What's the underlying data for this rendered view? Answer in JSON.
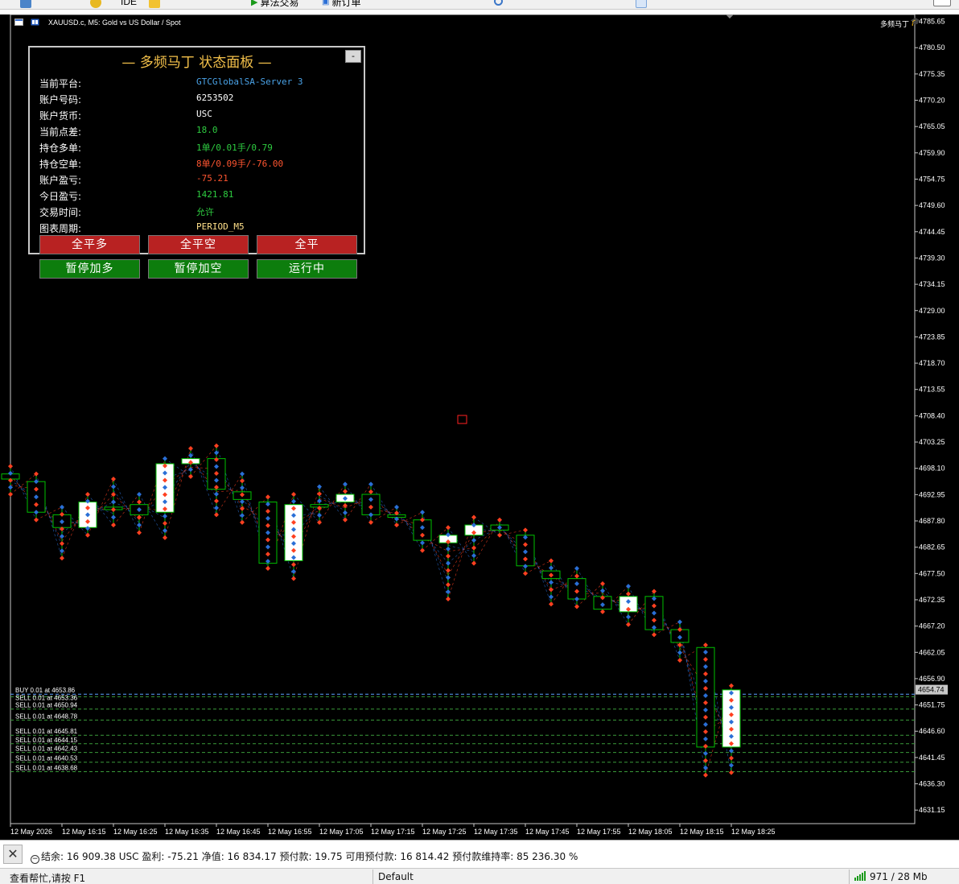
{
  "toolbar": {
    "algo_trading_label": "算法交易",
    "new_order_label": "新订单",
    "ide_label": "IDE"
  },
  "chart": {
    "title": "XAUUSD.c, M5:  Gold vs US Dollar / Spot",
    "ea_name": "多频马丁",
    "ea_icon": "graduation-cap-icon",
    "current_price": "4654.74",
    "y_ticks": [
      "4785.65",
      "4780.50",
      "4775.35",
      "4770.20",
      "4765.05",
      "4759.90",
      "4754.75",
      "4749.60",
      "4744.45",
      "4739.30",
      "4734.15",
      "4729.00",
      "4723.85",
      "4718.70",
      "4713.55",
      "4708.40",
      "4703.25",
      "4698.10",
      "4692.95",
      "4687.80",
      "4682.65",
      "4677.50",
      "4672.35",
      "4667.20",
      "4662.05",
      "4656.90",
      "4651.75",
      "4646.60",
      "4641.45",
      "4636.30",
      "4631.15"
    ],
    "x_ticks": [
      "12 May 2026",
      "12 May 16:15",
      "12 May 16:25",
      "12 May 16:35",
      "12 May 16:45",
      "12 May 16:55",
      "12 May 17:05",
      "12 May 17:15",
      "12 May 17:25",
      "12 May 17:35",
      "12 May 17:45",
      "12 May 17:55",
      "12 May 18:05",
      "12 May 18:15",
      "12 May 18:25"
    ],
    "order_lines": [
      {
        "label": "BUY 0.01 at 4653.86",
        "price": 4653.86,
        "side": "buy"
      },
      {
        "label": "SELL 0.01 at 4653.36",
        "price": 4653.36,
        "side": "sell"
      },
      {
        "label": "SELL 0.01 at 4650.94",
        "price": 4650.94,
        "side": "sell"
      },
      {
        "label": "SELL 0.01 at 4648.78",
        "price": 4648.78,
        "side": "sell"
      },
      {
        "label": "SELL 0.01 at 4645.81",
        "price": 4645.81,
        "side": "sell"
      },
      {
        "label": "SELL 0.01 at 4644.15",
        "price": 4644.15,
        "side": "sell"
      },
      {
        "label": "SELL 0.01 at 4642.43",
        "price": 4642.43,
        "side": "sell"
      },
      {
        "label": "SELL 0.01 at 4640.53",
        "price": 4640.53,
        "side": "sell"
      },
      {
        "label": "SELL 0.01 at 4638.68",
        "price": 4638.68,
        "side": "sell"
      }
    ]
  },
  "chart_data": {
    "type": "candlestick",
    "title": "XAUUSD.c, M5:  Gold vs US Dollar / Spot",
    "ylim": [
      4628.5,
      4787.0
    ],
    "candles": [
      {
        "o": 4697.0,
        "h": 4698.5,
        "l": 4693.0,
        "c": 4696.0
      },
      {
        "o": 4695.5,
        "h": 4697.0,
        "l": 4688.0,
        "c": 4689.5
      },
      {
        "o": 4689.0,
        "h": 4690.5,
        "l": 4680.5,
        "c": 4686.5
      },
      {
        "o": 4686.5,
        "h": 4693.0,
        "l": 4685.0,
        "c": 4691.5
      },
      {
        "o": 4690.5,
        "h": 4696.0,
        "l": 4687.0,
        "c": 4690.0
      },
      {
        "o": 4691.0,
        "h": 4693.0,
        "l": 4685.5,
        "c": 4689.0
      },
      {
        "o": 4689.5,
        "h": 4700.0,
        "l": 4684.5,
        "c": 4699.0
      },
      {
        "o": 4699.0,
        "h": 4702.0,
        "l": 4696.5,
        "c": 4700.0
      },
      {
        "o": 4700.0,
        "h": 4702.5,
        "l": 4689.0,
        "c": 4694.0
      },
      {
        "o": 4693.5,
        "h": 4697.0,
        "l": 4687.5,
        "c": 4692.0
      },
      {
        "o": 4691.5,
        "h": 4692.5,
        "l": 4678.5,
        "c": 4679.5
      },
      {
        "o": 4680.0,
        "h": 4693.0,
        "l": 4676.5,
        "c": 4691.0
      },
      {
        "o": 4691.0,
        "h": 4694.5,
        "l": 4687.5,
        "c": 4690.5
      },
      {
        "o": 4691.5,
        "h": 4695.0,
        "l": 4688.0,
        "c": 4693.0
      },
      {
        "o": 4693.0,
        "h": 4695.0,
        "l": 4687.5,
        "c": 4689.0
      },
      {
        "o": 4689.0,
        "h": 4690.5,
        "l": 4687.0,
        "c": 4688.5
      },
      {
        "o": 4688.0,
        "h": 4689.5,
        "l": 4682.0,
        "c": 4684.0
      },
      {
        "o": 4683.5,
        "h": 4686.5,
        "l": 4672.5,
        "c": 4685.0
      },
      {
        "o": 4685.0,
        "h": 4688.5,
        "l": 4679.5,
        "c": 4687.0
      },
      {
        "o": 4687.0,
        "h": 4688.0,
        "l": 4685.0,
        "c": 4686.0
      },
      {
        "o": 4685.0,
        "h": 4686.0,
        "l": 4677.5,
        "c": 4679.0
      },
      {
        "o": 4678.0,
        "h": 4680.0,
        "l": 4671.5,
        "c": 4676.5
      },
      {
        "o": 4676.5,
        "h": 4678.5,
        "l": 4671.0,
        "c": 4672.5
      },
      {
        "o": 4673.0,
        "h": 4675.5,
        "l": 4670.0,
        "c": 4670.5
      },
      {
        "o": 4670.0,
        "h": 4675.0,
        "l": 4667.5,
        "c": 4673.0
      },
      {
        "o": 4673.0,
        "h": 4674.0,
        "l": 4665.5,
        "c": 4666.5
      },
      {
        "o": 4666.5,
        "h": 4668.0,
        "l": 4660.5,
        "c": 4664.0
      },
      {
        "o": 4663.0,
        "h": 4663.5,
        "l": 4638.0,
        "c": 4643.5
      },
      {
        "o": 4643.5,
        "h": 4655.5,
        "l": 4638.5,
        "c": 4654.7
      }
    ]
  },
  "panel": {
    "title": "— 多频马丁 状态面板 —",
    "minimize_label": "-",
    "rows": [
      {
        "label": "当前平台:",
        "value": "GTCGlobalSA-Server 3",
        "color": "#4aa3e8"
      },
      {
        "label": "账户号码:",
        "value": "6253502",
        "color": "#ffffff"
      },
      {
        "label": "账户货币:",
        "value": "USC",
        "color": "#ffffff"
      },
      {
        "label": "当前点差:",
        "value": "18.0",
        "color": "#2ecc40"
      },
      {
        "label": "持仓多单:",
        "value": "1单/0.01手/0.79",
        "color": "#2ecc40"
      },
      {
        "label": "持仓空单:",
        "value": "8单/0.09手/-76.00",
        "color": "#ff5530"
      },
      {
        "label": "账户盈亏:",
        "value": "-75.21",
        "color": "#ff5530"
      },
      {
        "label": "今日盈亏:",
        "value": "1421.81",
        "color": "#2ecc40"
      },
      {
        "label": "交易时间:",
        "value": "允许",
        "color": "#2ecc40"
      },
      {
        "label": "图表周期:",
        "value": "PERIOD_M5",
        "color": "#ffe08a"
      }
    ],
    "buttons_row1": [
      "全平多",
      "全平空",
      "全平"
    ],
    "buttons_row2": [
      "暂停加多",
      "暂停加空",
      "运行中"
    ]
  },
  "account": {
    "text": "结余: 16 909.38 USC  盈利: -75.21  净值: 16 834.17  预付款: 19.75  可用预付款: 16 814.42  预付款维持率: 85 236.30 %"
  },
  "status": {
    "help": "查看帮忙,请按 F1",
    "profile": "Default",
    "network": "971 / 28 Mb"
  },
  "colors": {
    "bull": "#ffffff",
    "bear": "#000000",
    "candle_outline": "#00c000",
    "sell_line": "#3a9a3a",
    "buy_line": "#3a9a3a",
    "sell_arrow": "#ff4020",
    "buy_arrow": "#2a6fd6"
  }
}
